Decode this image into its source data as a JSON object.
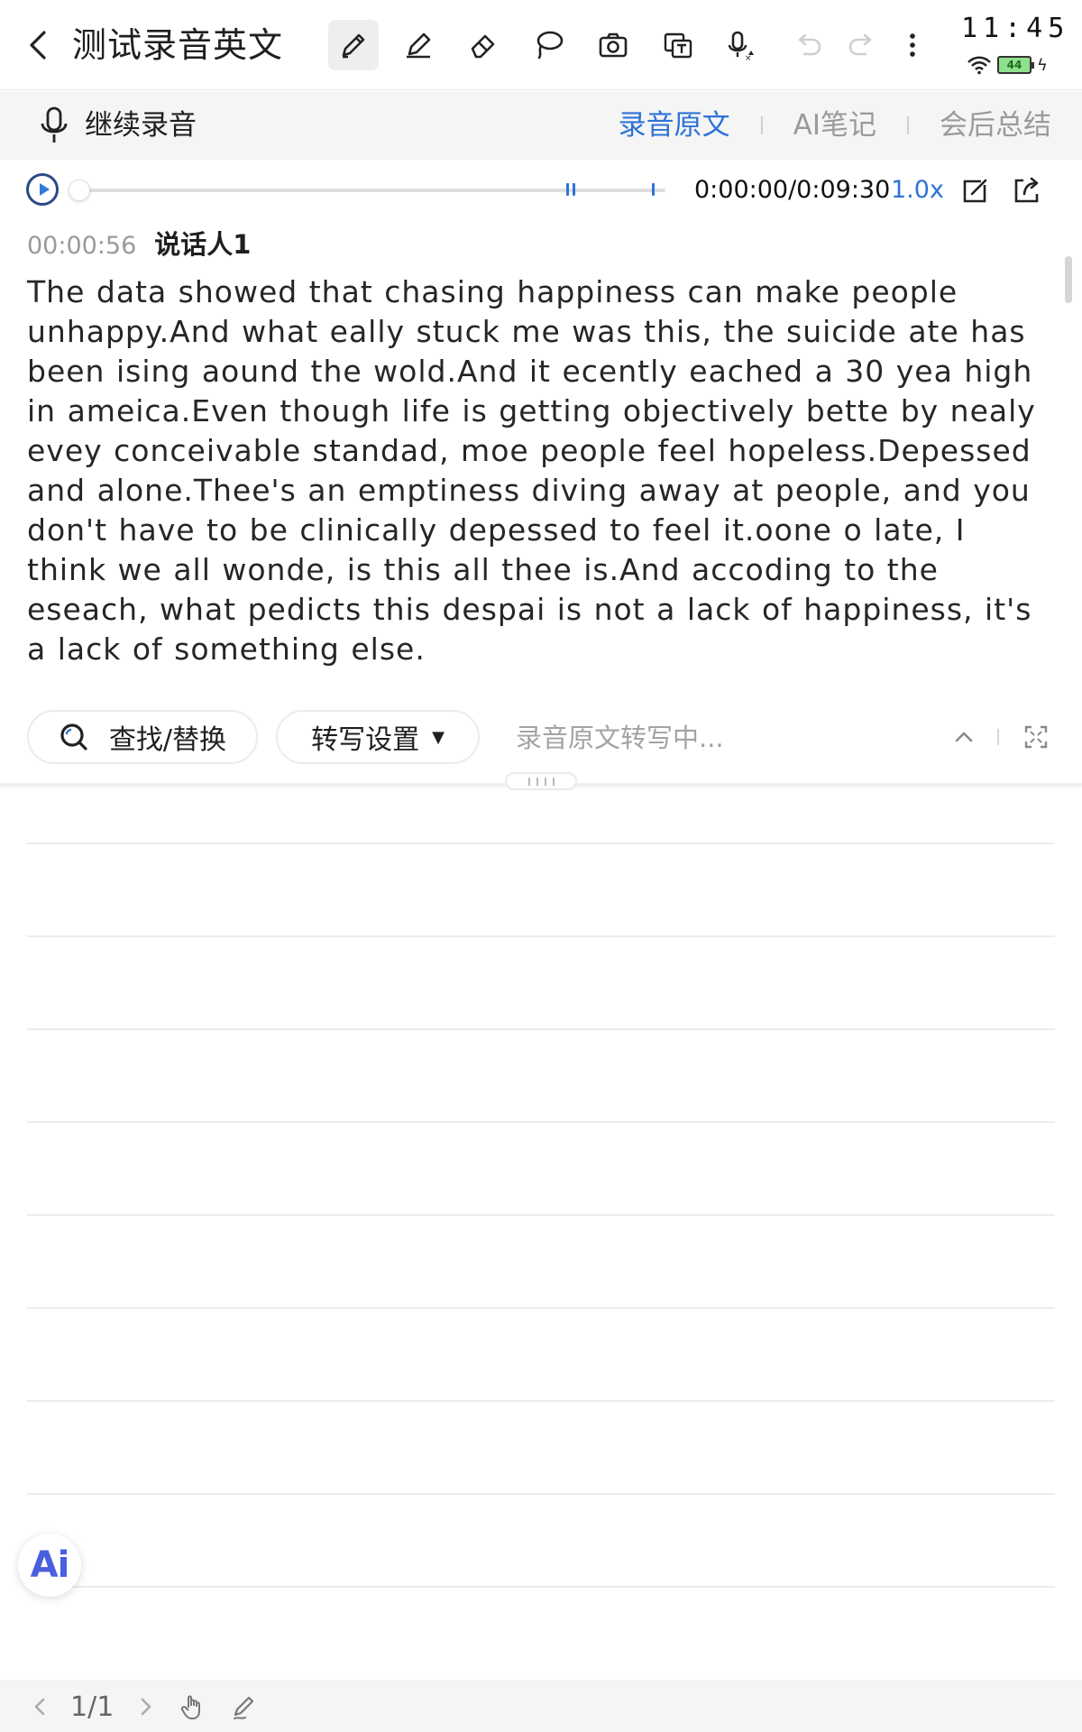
{
  "header": {
    "title": "测试录音英文",
    "tools": [
      "pen-icon",
      "highlighter-icon",
      "eraser-icon",
      "lasso-icon",
      "camera-icon",
      "text-recognize-icon",
      "voice-input-icon",
      "undo-icon",
      "redo-icon",
      "more-icon"
    ]
  },
  "status_bar": {
    "time": "11:45",
    "battery": "44"
  },
  "subbar": {
    "continue_label": "继续录音",
    "tabs": [
      {
        "label": "录音原文",
        "active": true
      },
      {
        "label": "AI笔记",
        "active": false
      },
      {
        "label": "会后总结",
        "active": false
      }
    ]
  },
  "player": {
    "time": "0:00:00/0:09:30",
    "speed": "1.0x",
    "progress": 0
  },
  "transcript": {
    "segments": [
      {
        "time": "00:00:56",
        "speaker": "说话人1",
        "text": "The data showed that chasing happiness can make people unhappy.And what eally stuck me was this, the suicide ate has been ising aound the wold.And it ecently eached a 30 yea high in ameica.Even though life is getting objectively bette by nealy evey conceivable standad, moe people feel hopeless.Depessed and alone.Thee's an emptiness diving away at people, and you don't have to be clinically depessed to feel it.oone o late, I think we all wonde, is this all thee is.And accoding to the eseach, what pedicts this despai is not a lack of happiness, it's a lack of something else."
      }
    ]
  },
  "search_row": {
    "find_label": "查找/替换",
    "settings_label": "转写设置",
    "status": "录音原文转写中..."
  },
  "notes": {
    "ai_label": "Ai"
  },
  "bottom": {
    "page": "1/1"
  },
  "colors": {
    "accent": "#2e73d6",
    "muted": "#9a9a9a",
    "subbar_bg": "#f5f5f6"
  }
}
